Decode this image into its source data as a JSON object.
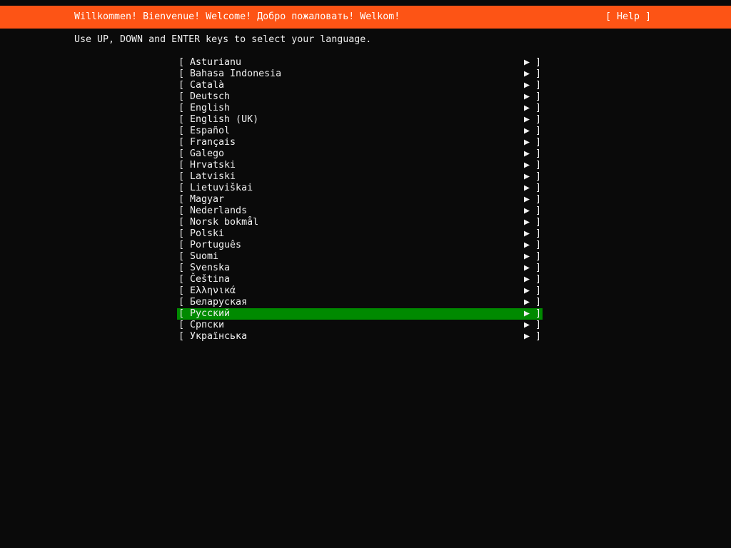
{
  "header": {
    "title": "Willkommen! Bienvenue! Welcome! Добро пожаловать! Welkom!",
    "help_label": "[ Help ]"
  },
  "instructions": "Use UP, DOWN and ENTER keys to select your language.",
  "colors": {
    "header": "#fd5415",
    "selected": "#008a00",
    "background": "#0a0a0a"
  },
  "languages": [
    "Asturianu",
    "Bahasa Indonesia",
    "Català",
    "Deutsch",
    "English",
    "English (UK)",
    "Español",
    "Français",
    "Galego",
    "Hrvatski",
    "Latviski",
    "Lietuviškai",
    "Magyar",
    "Nederlands",
    "Norsk bokmål",
    "Polski",
    "Português",
    "Suomi",
    "Svenska",
    "Čeština",
    "Ελληνικά",
    "Беларуская",
    "Русский",
    "Српски",
    "Українська"
  ],
  "selected_index": 22,
  "row_prefix": "[ ",
  "row_suffix": "▶ ]"
}
